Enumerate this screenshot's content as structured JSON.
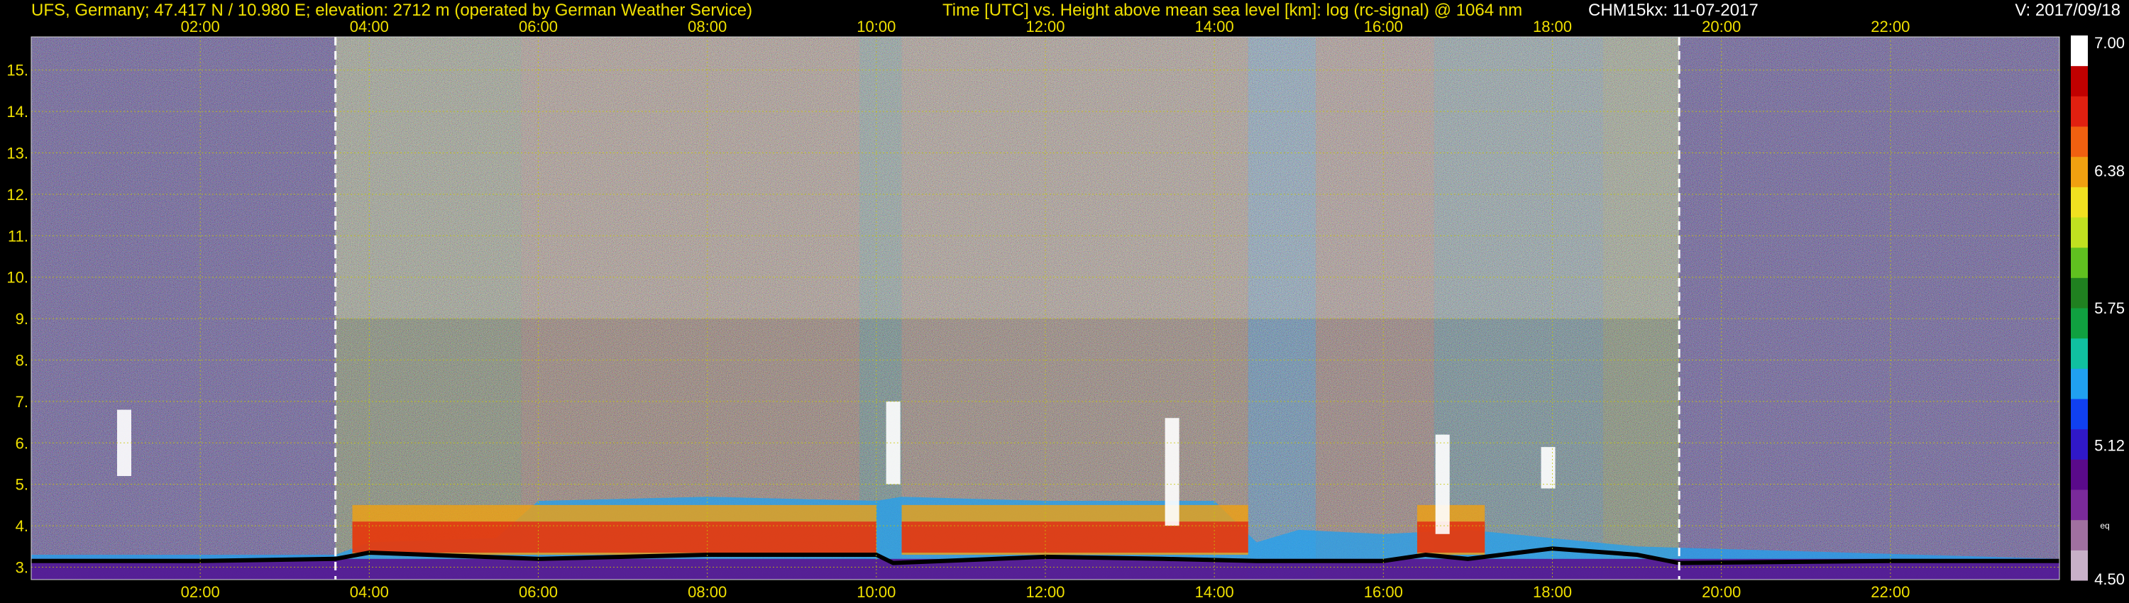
{
  "header": {
    "station": "UFS, Germany; 47.417 N / 10.980 E; elevation: 2712 m  (operated by German Weather Service)",
    "description": "Time [UTC] vs. Height above mean sea level [km]: log (rc-signal) @ 1064 nm",
    "instrument": "CHM15kx: 11-07-2017",
    "version": "V: 2017/09/18"
  },
  "chart_data": {
    "type": "heatmap",
    "title": "Time [UTC] vs. Height above mean sea level [km]: log (rc-signal) @ 1064 nm",
    "xlabel": "Time [UTC]",
    "ylabel": "Height above mean sea level [km]",
    "xlim": [
      0.0,
      24.0
    ],
    "ylim": [
      2.7,
      15.8
    ],
    "x_ticks": [
      "02:00",
      "04:00",
      "06:00",
      "08:00",
      "10:00",
      "12:00",
      "14:00",
      "16:00",
      "18:00",
      "20:00",
      "22:00"
    ],
    "x_tick_hours": [
      2,
      4,
      6,
      8,
      10,
      12,
      14,
      16,
      18,
      20,
      22
    ],
    "y_ticks": [
      "3.",
      "4.",
      "5.",
      "6.",
      "7.",
      "8.",
      "9.",
      "10.",
      "11.",
      "12.",
      "13.",
      "14.",
      "15."
    ],
    "y_tick_km": [
      3,
      4,
      5,
      6,
      7,
      8,
      9,
      10,
      11,
      12,
      13,
      14,
      15
    ],
    "grid": true,
    "grid_color": "#c8c800",
    "dashed_markers_hours": [
      3.6,
      19.5
    ],
    "colorbar": {
      "min": 4.5,
      "max": 7.0,
      "ticks": [
        "4.50",
        "5.12",
        "5.75",
        "6.38",
        "7.00"
      ],
      "tick_values": [
        4.5,
        5.12,
        5.75,
        6.38,
        7.0
      ],
      "unit_label": "eq",
      "colors": [
        "#c8b0c8",
        "#a070a0",
        "#7a2a9a",
        "#5a0a8a",
        "#3018c8",
        "#1040f0",
        "#20a0f0",
        "#10c0a0",
        "#10a040",
        "#208020",
        "#60c020",
        "#c0e020",
        "#f0e020",
        "#f0a010",
        "#f06010",
        "#e02010",
        "#c00000",
        "#ffffff"
      ]
    },
    "boundary_layer_top_km": {
      "hours": [
        0,
        2,
        3.6,
        4,
        6,
        8,
        10,
        10.2,
        12,
        13.4,
        14.5,
        16,
        16.5,
        17,
        18,
        19,
        19.5,
        22,
        24
      ],
      "values": [
        3.15,
        3.15,
        3.2,
        3.35,
        3.2,
        3.3,
        3.3,
        3.1,
        3.25,
        3.2,
        3.15,
        3.15,
        3.3,
        3.2,
        3.45,
        3.3,
        3.1,
        3.15,
        3.15
      ]
    },
    "aerosol_layer_top_km": {
      "hours": [
        0,
        3.6,
        4,
        5.5,
        6,
        8,
        10,
        10.3,
        12,
        14,
        14.5,
        15,
        16,
        17,
        18,
        19,
        24
      ],
      "values": [
        3.3,
        3.3,
        3.6,
        3.7,
        4.6,
        4.7,
        4.6,
        4.7,
        4.6,
        4.6,
        3.6,
        3.9,
        3.8,
        3.9,
        3.7,
        3.5,
        3.2
      ]
    },
    "cloud_features": [
      {
        "hour": 1.1,
        "base_km": 5.2,
        "top_km": 6.8
      },
      {
        "hour": 10.2,
        "base_km": 5.0,
        "top_km": 7.0
      },
      {
        "hour": 13.5,
        "base_km": 4.0,
        "top_km": 6.6
      },
      {
        "hour": 16.7,
        "base_km": 3.8,
        "top_km": 6.2
      },
      {
        "hour": 17.95,
        "base_km": 4.9,
        "top_km": 5.9
      }
    ]
  }
}
